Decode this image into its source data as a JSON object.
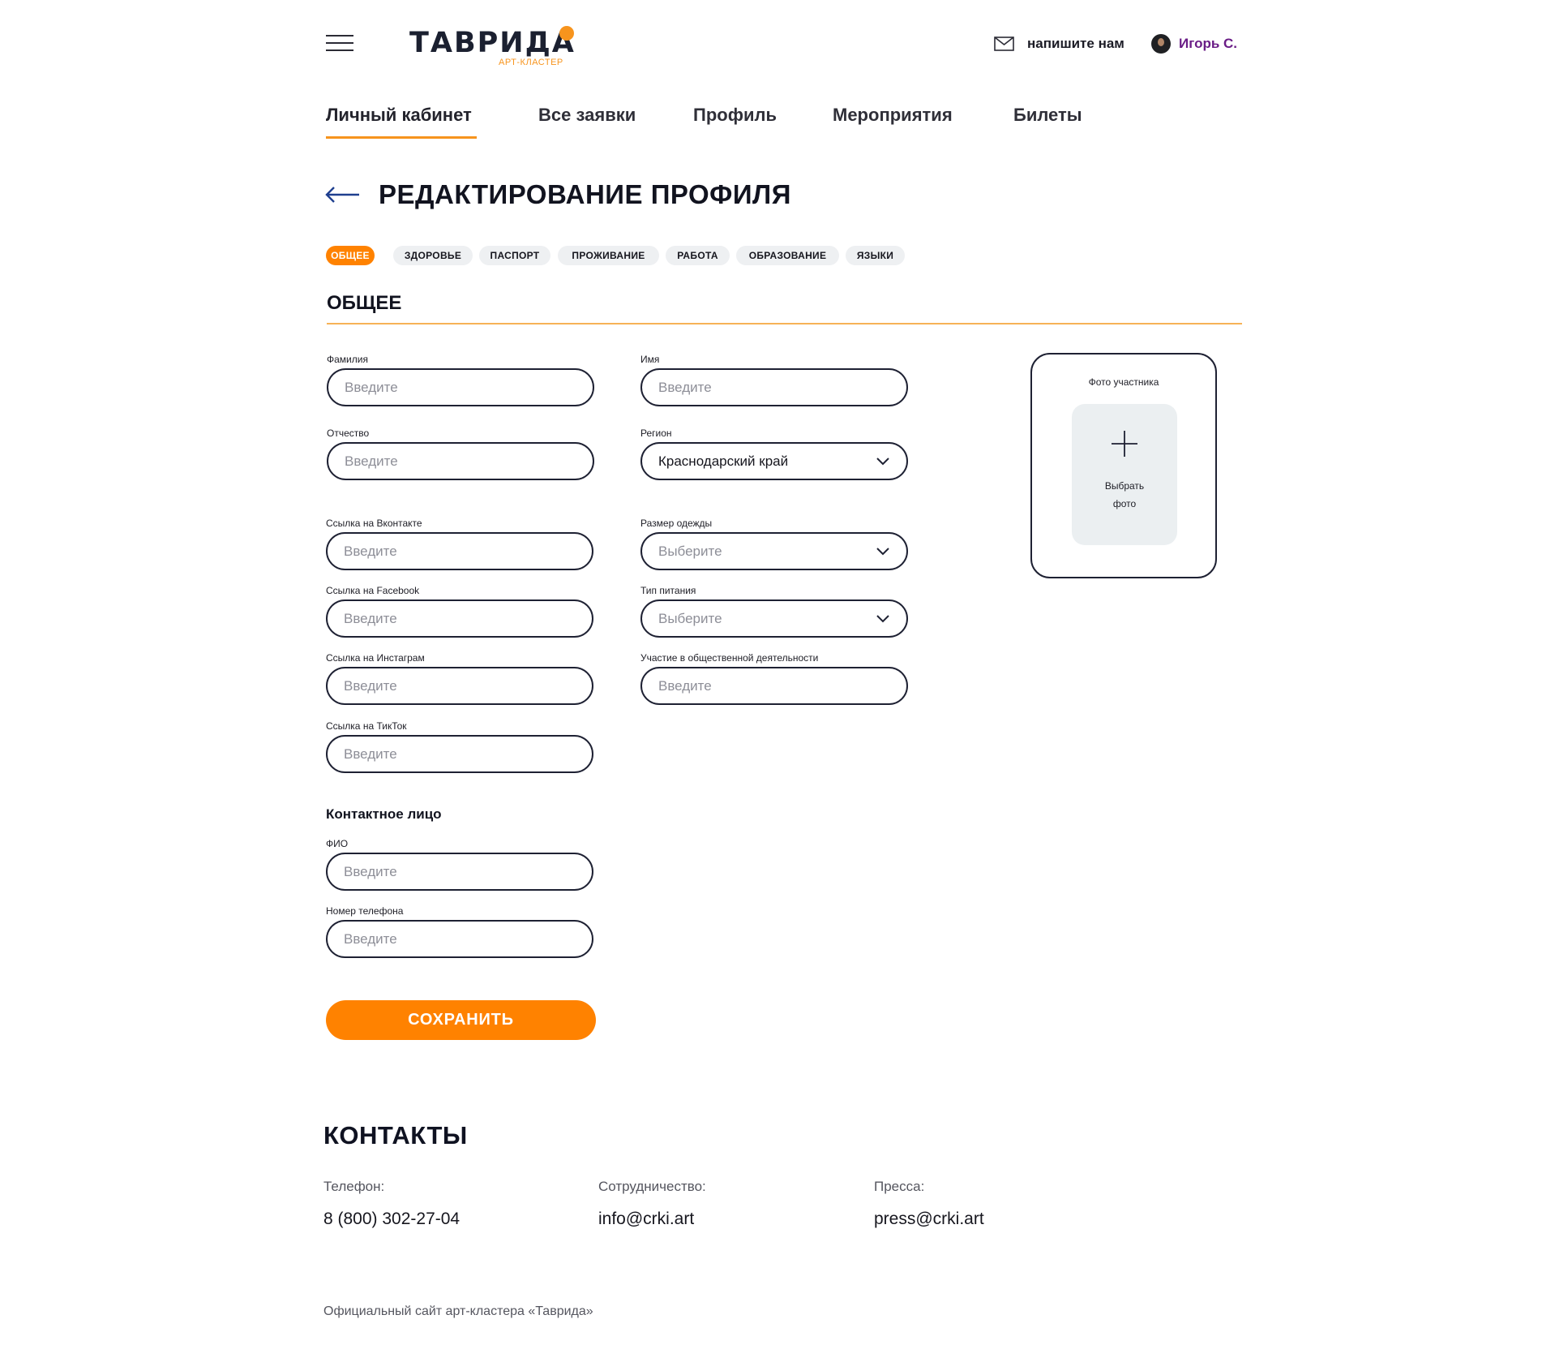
{
  "header": {
    "logo_main": "ТАВРИДА",
    "logo_sub": "АРТ-КЛАСТЕР",
    "write_us": "напишите нам",
    "user_name": "Игорь С."
  },
  "nav": [
    "Личный кабинет",
    "Все заявки",
    "Профиль",
    "Мероприятия",
    "Билеты"
  ],
  "nav_active": "Личный кабинет",
  "page_title": "РЕДАКТИРОВАНИЕ ПРОФИЛЯ",
  "sections": [
    "ОБЩЕЕ",
    "ЗДОРОВЬЕ",
    "ПАСПОРТ",
    "ПРОЖИВАНИЕ",
    "РАБОТА",
    "ОБРАЗОВАНИЕ",
    "ЯЗЫКИ"
  ],
  "section_active": "ОБЩЕЕ",
  "section_title": "ОБЩЕЕ",
  "form": {
    "surname": {
      "label": "Фамилия",
      "placeholder": "Введите"
    },
    "first_name": {
      "label": "Имя",
      "placeholder": "Введите"
    },
    "patronymic": {
      "label": "Отчество",
      "placeholder": "Введите"
    },
    "region": {
      "label": "Регион",
      "value": "Краснодарский край"
    },
    "vk": {
      "label": "Ссылка на Вконтакте",
      "placeholder": "Введите"
    },
    "clothing_size": {
      "label": "Размер одежды",
      "placeholder": "Выберите"
    },
    "facebook": {
      "label": "Ссылка на Facebook",
      "placeholder": "Введите"
    },
    "food_type": {
      "label": "Тип питания",
      "placeholder": "Выберите"
    },
    "instagram": {
      "label": "Ссылка на Инстаграм",
      "placeholder": "Введите"
    },
    "public_activity": {
      "label": "Участие в общественной деятельности",
      "placeholder": "Введите"
    },
    "tiktok": {
      "label": "Ссылка на ТикТок",
      "placeholder": "Введите"
    }
  },
  "contact_person": {
    "title": "Контактное лицо",
    "full_name": {
      "label": "ФИО",
      "placeholder": "Введите"
    },
    "phone": {
      "label": "Номер телефона",
      "placeholder": "Введите"
    }
  },
  "save_label": "СОХРАНИТЬ",
  "photo": {
    "title": "Фото участника",
    "choose_line1": "Выбрать",
    "choose_line2": "фото"
  },
  "contacts": {
    "title": "КОНТАКТЫ",
    "phone_label": "Телефон:",
    "phone_value": "8 (800) 302-27-04",
    "coop_label": "Сотрудничество:",
    "coop_value": "info@crki.art",
    "press_label": "Пресса:",
    "press_value": "press@crki.art"
  },
  "footer_note": "Официальный сайт арт-кластера «Таврида»",
  "colors": {
    "accent": "#ff8200",
    "dark": "#1e2133",
    "user_name": "#6a1d86",
    "back_arrow": "#1f3f8f"
  },
  "icons": [
    "menu-icon",
    "mail-icon",
    "avatar",
    "back-arrow-icon",
    "chevron-down-icon",
    "plus-icon"
  ]
}
